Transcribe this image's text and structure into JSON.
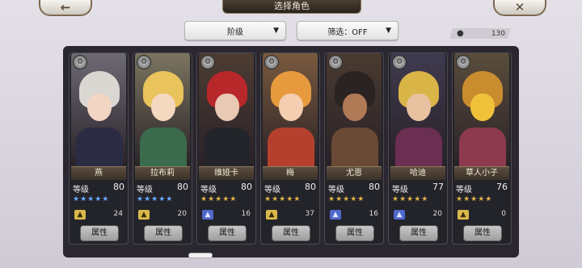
{
  "header": {
    "title": "选择角色",
    "back_icon": "left-arrow-icon",
    "close_icon": "close-icon"
  },
  "filters": {
    "rank_label": "阶级",
    "filter_label": "筛选：OFF"
  },
  "collection": {
    "count": "130"
  },
  "cards": [
    {
      "name": "燕",
      "level_label": "等级",
      "level": "80",
      "star_color": "blue",
      "stars": "★★★★★",
      "rank_icon": "gold",
      "rank_count": "24",
      "attr_label": "属性",
      "palette": {
        "hair": "#d9d7d2",
        "skin": "#f2d6c4",
        "body": "#2b2c44",
        "bg": "#6e6a75"
      }
    },
    {
      "name": "拉布莉",
      "level_label": "等级",
      "level": "80",
      "star_color": "blue",
      "stars": "★★★★★",
      "rank_icon": "gold",
      "rank_count": "20",
      "attr_label": "属性",
      "palette": {
        "hair": "#e9c35b",
        "skin": "#f4d8c0",
        "body": "#3a6b4c",
        "bg": "#7b7560"
      }
    },
    {
      "name": "维娅卡",
      "level_label": "等级",
      "level": "80",
      "star_color": "gold",
      "stars": "★★★★★",
      "rank_icon": "blue",
      "rank_count": "16",
      "attr_label": "属性",
      "palette": {
        "hair": "#b8282b",
        "skin": "#e9c8b4",
        "body": "#23252a",
        "bg": "#4d3c33"
      }
    },
    {
      "name": "梅",
      "level_label": "等级",
      "level": "80",
      "star_color": "gold",
      "stars": "★★★★★",
      "rank_icon": "gold",
      "rank_count": "37",
      "attr_label": "属性",
      "palette": {
        "hair": "#e79a3d",
        "skin": "#f3ceb0",
        "body": "#b6402e",
        "bg": "#7a5a3e"
      }
    },
    {
      "name": "尤恩",
      "level_label": "等级",
      "level": "80",
      "star_color": "gold",
      "stars": "★★★★★",
      "rank_icon": "blue",
      "rank_count": "16",
      "attr_label": "属性",
      "palette": {
        "hair": "#2a2321",
        "skin": "#b07a57",
        "body": "#6a4a34",
        "bg": "#4a3a30"
      }
    },
    {
      "name": "哈迪",
      "level_label": "等级",
      "level": "77",
      "star_color": "gold",
      "stars": "★★★★★",
      "rank_icon": "blue",
      "rank_count": "20",
      "attr_label": "属性",
      "palette": {
        "hair": "#d9b548",
        "skin": "#e8c2a0",
        "body": "#6b2f52",
        "bg": "#3f3a4f"
      }
    },
    {
      "name": "草人小子",
      "level_label": "等级",
      "level": "76",
      "star_color": "gold",
      "stars": "★★★★★",
      "rank_icon": "gold",
      "rank_count": "0",
      "attr_label": "属性",
      "palette": {
        "hair": "#c98c2e",
        "skin": "#f0c23a",
        "body": "#8d3a4e",
        "bg": "#5a4d3c"
      }
    }
  ]
}
